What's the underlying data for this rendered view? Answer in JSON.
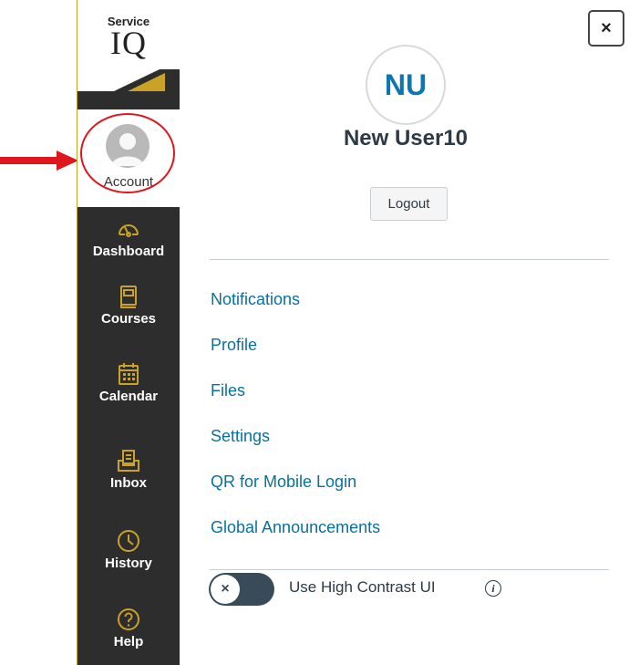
{
  "brand": {
    "line1": "Service",
    "line2": "IQ",
    "accent_color": "#c9a227"
  },
  "nav": {
    "account_label": "Account",
    "items": [
      {
        "label": "Dashboard",
        "icon": "dashboard-gauge-icon"
      },
      {
        "label": "Courses",
        "icon": "courses-book-icon"
      },
      {
        "label": "Calendar",
        "icon": "calendar-icon"
      },
      {
        "label": "Inbox",
        "icon": "inbox-icon"
      },
      {
        "label": "History",
        "icon": "clock-history-icon"
      },
      {
        "label": "Help",
        "icon": "help-question-icon"
      }
    ]
  },
  "tray": {
    "close_label": "×",
    "avatar_initials": "NU",
    "user_name": "New User10",
    "logout_label": "Logout",
    "links": [
      "Notifications",
      "Profile",
      "Files",
      "Settings",
      "QR for Mobile Login",
      "Global Announcements"
    ],
    "high_contrast": {
      "label": "Use High Contrast UI",
      "enabled": false,
      "knob_glyph": "×",
      "info_glyph": "i"
    }
  },
  "annotation": {
    "arrow_color": "#e0161d",
    "ring_color": "#e0161d"
  }
}
